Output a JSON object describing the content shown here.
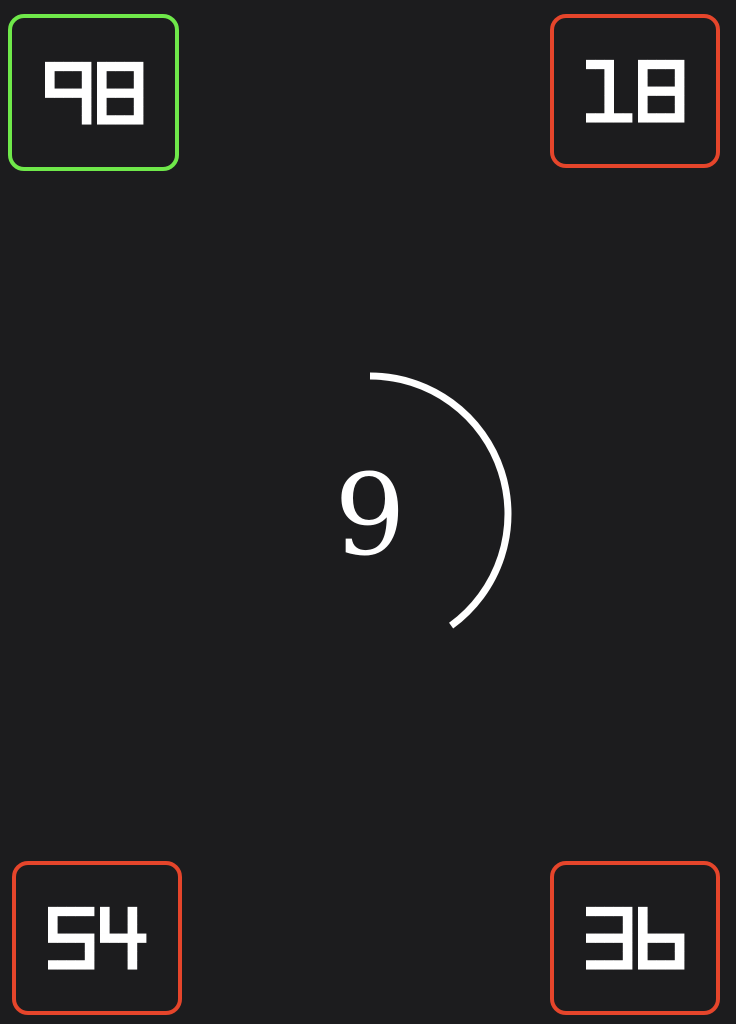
{
  "game": {
    "center_number": "9",
    "timer_remaining_fraction": 0.4,
    "options": [
      {
        "position": "top-left",
        "value": "98",
        "status": "correct"
      },
      {
        "position": "top-right",
        "value": "18",
        "status": "wrong"
      },
      {
        "position": "bottom-left",
        "value": "54",
        "status": "wrong"
      },
      {
        "position": "bottom-right",
        "value": "36",
        "status": "wrong"
      }
    ]
  },
  "colors": {
    "background": "#1c1c1e",
    "correct": "#6fe84a",
    "wrong": "#e5452b",
    "foreground": "#ffffff"
  }
}
